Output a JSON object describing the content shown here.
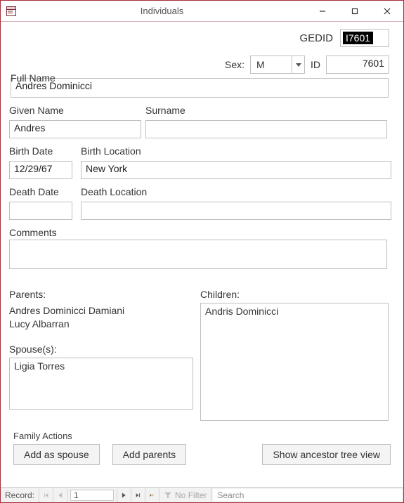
{
  "window": {
    "title": "Individuals"
  },
  "header": {
    "gedid_label": "GEDID",
    "gedid_value": "I7601",
    "sex_label": "Sex:",
    "sex_value": "M",
    "id_label": "ID",
    "id_value": "7601"
  },
  "fields": {
    "full_name_label": "Full Name",
    "full_name": "Andres Dominicci",
    "given_name_label": "Given Name",
    "given_name": "Andres",
    "surname_label": "Surname",
    "surname": "",
    "birth_date_label": "Birth Date",
    "birth_date": "12/29/67",
    "birth_location_label": "Birth Location",
    "birth_location": "New York",
    "death_date_label": "Death Date",
    "death_date": "",
    "death_location_label": "Death Location",
    "death_location": "",
    "comments_label": "Comments",
    "comments": ""
  },
  "relations": {
    "parents_label": "Parents:",
    "parents": [
      "Andres Dominicci Damiani",
      "Lucy Albarran"
    ],
    "spouses_label": "Spouse(s):",
    "spouses": [
      "Ligia Torres"
    ],
    "children_label": "Children:",
    "children": [
      "Andris Dominicci"
    ]
  },
  "family_actions": {
    "group_label": "Family Actions",
    "add_spouse": "Add as spouse",
    "add_parents": "Add parents",
    "show_ancestor": "Show ancestor tree view"
  },
  "statusbar": {
    "record_label": "Record:",
    "current": "1",
    "no_filter": "No Filter",
    "search_placeholder": "Search"
  }
}
